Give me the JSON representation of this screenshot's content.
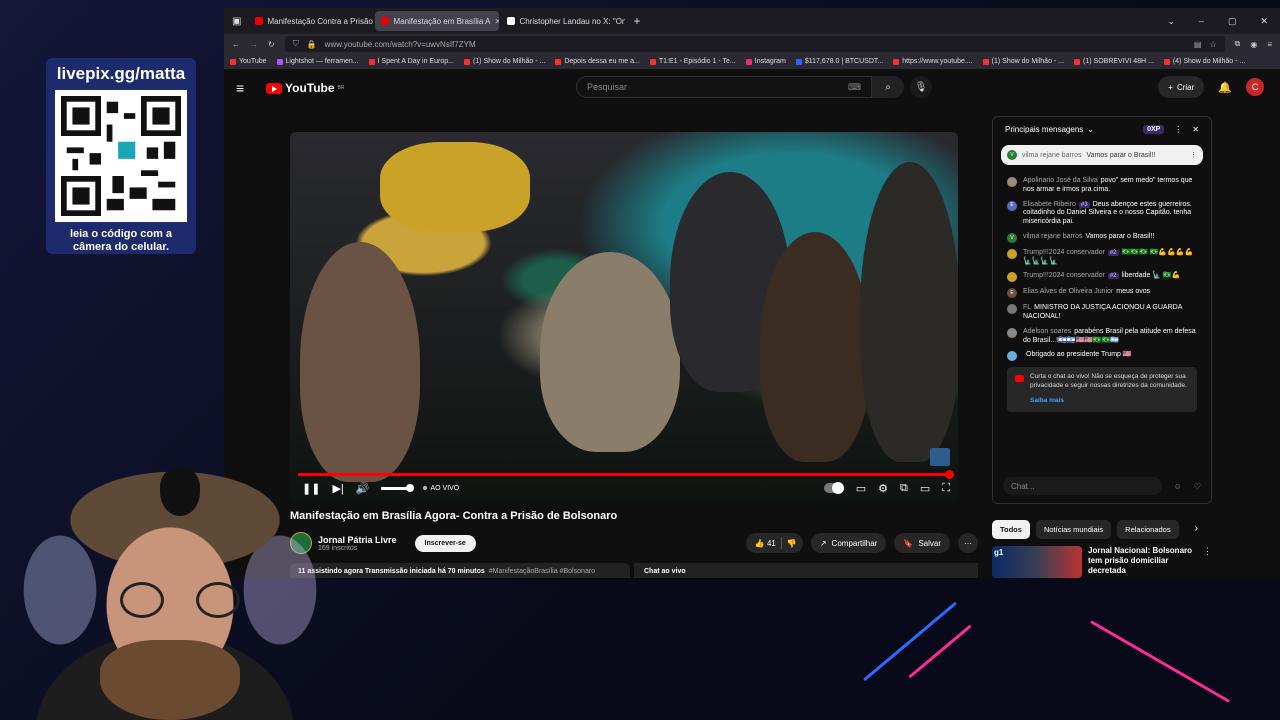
{
  "overlay": {
    "qr_title": "livepix.gg/matta",
    "qr_caption": "leia o código com a câmera do celular."
  },
  "browser": {
    "tabs": [
      {
        "label": "Manifestação Contra a Prisão d",
        "active": false
      },
      {
        "label": "Manifestação em Brasília A",
        "active": true
      },
      {
        "label": "Christopher Landau no X: \"One",
        "active": false
      }
    ],
    "url": "www.youtube.com/watch?v=uwvNsIf7ZYM",
    "bookmarks": [
      "YouTube",
      "Lightshot — ferramen...",
      "I Spent A Day in Europ...",
      "(1) Show do Milhão - ...",
      "Depois dessa eu me a...",
      "T1:E1 - Episódio 1 - Te...",
      "Instagram",
      "$117,678.0 | BTCUSDT...",
      "https://www.youtube....",
      "(1) Show do Milhão - ...",
      "(1) SOBREVIVI 48H ...",
      "(4) Show do Milhão - ..."
    ]
  },
  "youtube": {
    "logo_text": "YouTube",
    "logo_region": "BR",
    "search_placeholder": "Pesquisar",
    "create_label": "Criar",
    "avatar_letter": "C"
  },
  "player": {
    "live_label": "AO VIVO"
  },
  "video": {
    "title": "Manifestação em Brasília Agora- Contra a Prisão de Bolsonaro",
    "channel_name": "Jornal Pátria Livre",
    "channel_subs": "169 inscritos",
    "subscribe_label": "Inscrever-se",
    "likes": "41",
    "share_label": "Compartilhar",
    "save_label": "Salvar",
    "desc_stats": "11 assistindo agora  Transmissão iniciada há 70 minutos",
    "desc_tags": "#ManifestaçãoBrasília #Bolsonaro",
    "chat_bar_label": "Chat ao vivo"
  },
  "chat": {
    "header": "Principais mensagens",
    "xp": "0XP",
    "pinned": {
      "author": "vilma rejane barros",
      "text": "Vamos parar o Brasil!!",
      "color": "#2e7d32",
      "initial": "V"
    },
    "messages": [
      {
        "author": "Apolinario José da Silva",
        "badge": "",
        "text": "povo\" sem medo\" termos que nos armar e irmos pra cima.",
        "color": "#9e8a7a",
        "initial": ""
      },
      {
        "author": "Elisabete Ribeiro",
        "badge": "#3",
        "text": "Deus abençoe estes guerreiros. coitadinho do Daniel Silveira e o nosso Capitão. tenha misericórdia pai.",
        "color": "#5c6bc0",
        "initial": "E"
      },
      {
        "author": "vilma rejane barros",
        "badge": "",
        "text": "Vamos parar o Brasil!!",
        "color": "#2e7d32",
        "initial": "V"
      },
      {
        "author": "Trump!!!2024 conservador",
        "badge": "#2",
        "text": "🇧🇷🇧🇷🇧🇷 🇧🇷💪💪💪💪🗽🗽🗽🗽",
        "color": "#c9a227",
        "initial": ""
      },
      {
        "author": "Trump!!!2024 conservador",
        "badge": "#2",
        "text": "liberdade 🗽 🇧🇷💪",
        "color": "#c9a227",
        "initial": ""
      },
      {
        "author": "Elias Alves de Oliveira Junior",
        "badge": "",
        "text": "meus ovos",
        "color": "#6d4c41",
        "initial": "E"
      },
      {
        "author": "FL",
        "badge": "",
        "text": "MINISTRO DA JUSTIÇA ACIONOU A GUARDA NACIONAL!",
        "color": "#777777",
        "initial": ""
      },
      {
        "author": "Adelson soares",
        "badge": "",
        "text": "parabéns Brasil pela atitude em defesa do Brasil...!🇮🇱🇮🇱🇺🇸🇺🇸🇧🇷🇧🇷🇦🇷",
        "color": "#888888",
        "initial": ""
      },
      {
        "author": "",
        "badge": "",
        "text": "Obrigado ao presidente Trump 🇺🇸",
        "color": "#6fa8dc",
        "initial": ""
      }
    ],
    "notice": "Curta o chat ao vivo! Não se esqueça de proteger sua privacidade e seguir nossas diretrizes da comunidade.",
    "notice_link": "Saiba mais",
    "input_placeholder": "Chat..."
  },
  "recommendations": {
    "chips": [
      "Todos",
      "Notícias mundiais",
      "Relacionados"
    ],
    "item_title": "Jornal Nacional: Bolsonaro tem prisão domiciliar decretada",
    "item_thumb_label": "g1"
  }
}
